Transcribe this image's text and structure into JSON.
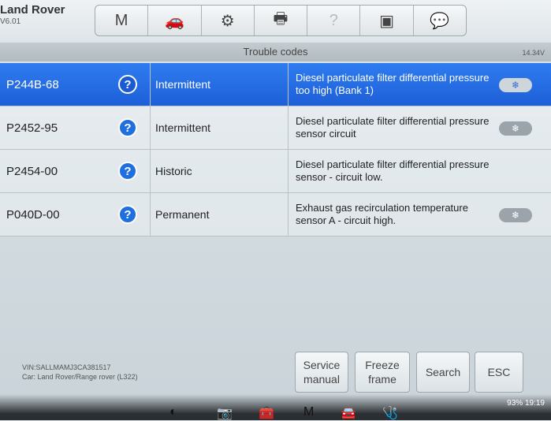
{
  "header": {
    "title": "Land Rover",
    "version": "V6.01"
  },
  "toolbar": [
    {
      "name": "home-icon",
      "glyph": "M"
    },
    {
      "name": "vehicle-swap-icon",
      "glyph": "🚗"
    },
    {
      "name": "settings-icon",
      "glyph": "⚙"
    },
    {
      "name": "print-icon",
      "glyph": "🖶"
    },
    {
      "name": "help-icon",
      "glyph": "?"
    },
    {
      "name": "save-icon",
      "glyph": "▣"
    },
    {
      "name": "messages-icon",
      "glyph": "💬"
    }
  ],
  "titlebar": {
    "title": "Trouble codes",
    "status": "14.34V"
  },
  "codes": [
    {
      "code": "P244B-68",
      "status": "Intermittent",
      "desc": "Diesel particulate filter differential pressure too high (Bank 1)",
      "selected": true
    },
    {
      "code": "P2452-95",
      "status": "Intermittent",
      "desc": "Diesel particulate filter differential pressure sensor circuit",
      "selected": false
    },
    {
      "code": "P2454-00",
      "status": "Historic",
      "desc": "Diesel particulate filter differential pressure sensor - circuit low.",
      "selected": false
    },
    {
      "code": "P040D-00",
      "status": "Permanent",
      "desc": "Exhaust gas recirculation temperature sensor A - circuit high.",
      "selected": false
    }
  ],
  "footer": {
    "vin": "VIN:SALLMAMJ3CA381517",
    "car": "Car: Land Rover/Range rover (L322)",
    "buttons": {
      "service_manual": "Service manual",
      "freeze_frame": "Freeze frame",
      "search": "Search",
      "esc": "ESC"
    }
  },
  "system": {
    "battery": "93%",
    "time": "19:19"
  }
}
